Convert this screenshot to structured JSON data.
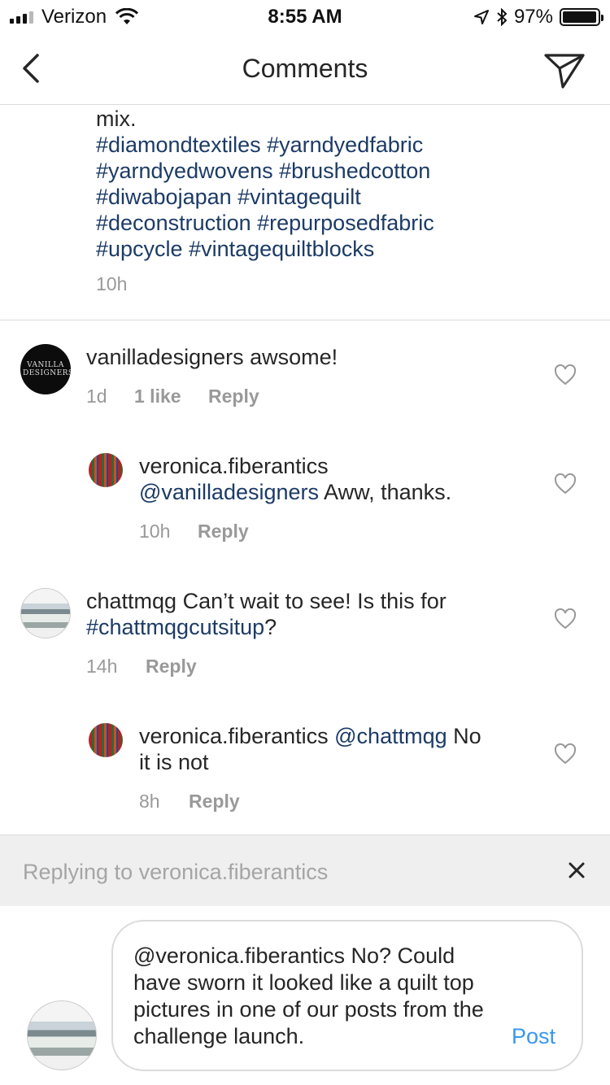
{
  "status_bar": {
    "carrier": "Verizon",
    "time": "8:55 AM",
    "battery": "97%",
    "battery_level": 0.97
  },
  "nav": {
    "title": "Comments",
    "back_icon": "chevron-left-icon",
    "send_icon": "paper-plane-icon"
  },
  "caption": {
    "text_start": "mix.",
    "hashtag_lines": [
      "#diamondtextiles #yarndyedfabric",
      "#yarndyedwovens #brushedcotton",
      "#diwabojapan #vintagequilt",
      "#deconstruction #repurposedfabric",
      "#upcycle #vintagequiltblocks"
    ],
    "time": "10h"
  },
  "comments": [
    {
      "avatar_text": "VANILLA DESIGNERS",
      "username": "vanilladesigners",
      "text": " awsome!",
      "time": "1d",
      "likes": "1 like",
      "reply": "Reply"
    },
    {
      "username": "veronica.fiberantics",
      "mention": "@vanilladesigners",
      "text": " Aww, thanks.",
      "time": "10h",
      "reply": "Reply"
    },
    {
      "username": "chattmqg",
      "text": " Can’t wait to see! Is this for",
      "hashtag": "#chattmqgcutsitup",
      "text_end": "?",
      "time": "14h",
      "reply": "Reply"
    },
    {
      "username": "veronica.fiberantics",
      "mention": "@chattmqg",
      "text": " No",
      "text_line2": "it is not",
      "time": "8h",
      "reply": "Reply"
    }
  ],
  "reply_bar": {
    "text": "Replying to veronica.fiberantics"
  },
  "compose": {
    "value": "@veronica.fiberantics No? Could have sworn it looked like a quilt top pictures in one of our posts from the challenge launch.",
    "post_label": "Post"
  },
  "colors": {
    "link": "#1c3b66",
    "post": "#3897f0",
    "meta": "#999999"
  }
}
